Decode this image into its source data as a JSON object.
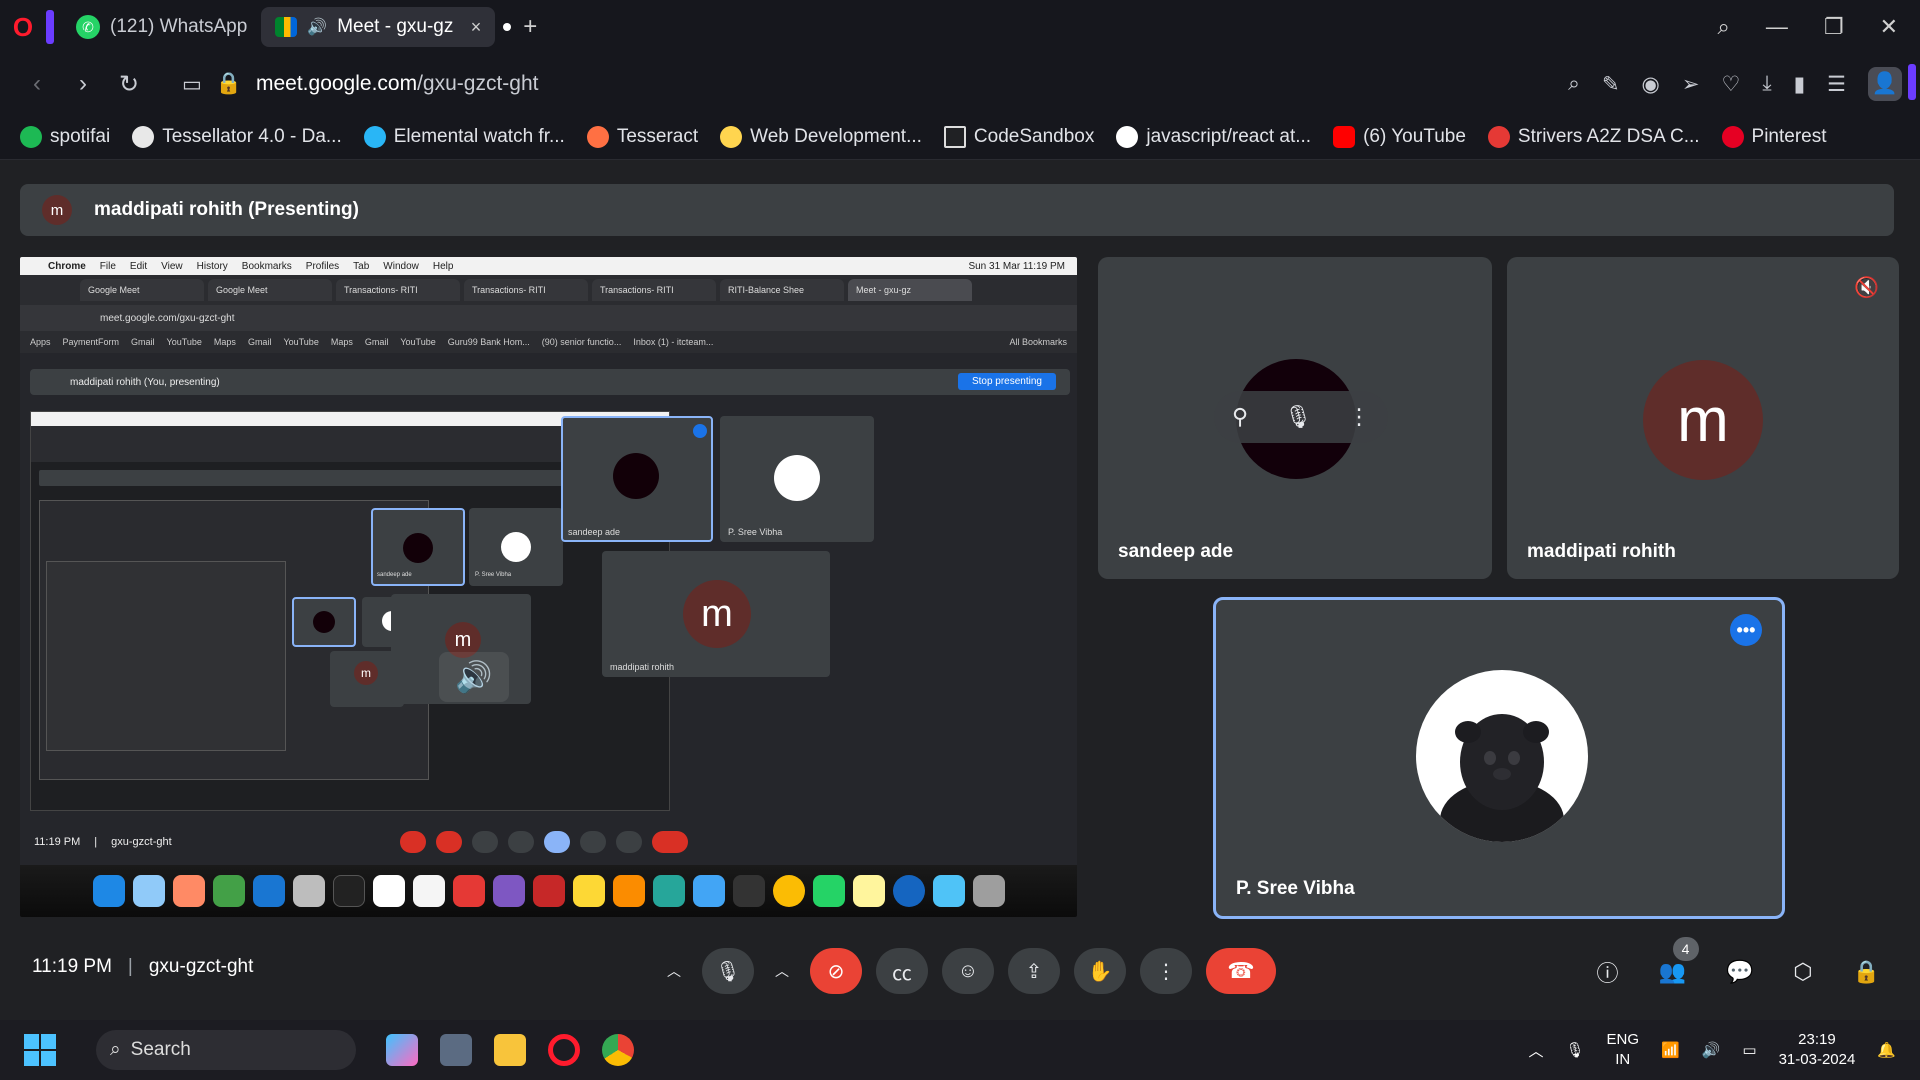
{
  "browser": {
    "tabs": [
      {
        "label": "(121) WhatsApp"
      },
      {
        "label": "Meet - gxu-gz",
        "close": "×"
      }
    ],
    "url_host": "meet.google.com",
    "url_path": "/gxu-gzct-ght",
    "bookmarks": [
      {
        "label": "spotifai",
        "color": "#1db954"
      },
      {
        "label": "Tessellator 4.0 - Da...",
        "color": "#e8e8e8"
      },
      {
        "label": "Elemental watch fr...",
        "color": "#29b6f6"
      },
      {
        "label": "Tesseract",
        "color": "#ff7043"
      },
      {
        "label": "Web Development...",
        "color": "#ffd54f"
      },
      {
        "label": "CodeSandbox",
        "color": "#202124"
      },
      {
        "label": "javascript/react at...",
        "color": "#ffffff"
      },
      {
        "label": "(6) YouTube",
        "color": "#ff0000"
      },
      {
        "label": "Strivers A2Z DSA C...",
        "color": "#e53935"
      },
      {
        "label": "Pinterest",
        "color": "#e60023"
      }
    ]
  },
  "meet": {
    "presenter_initial": "m",
    "presenter_label": "maddipati rohith (Presenting)",
    "shared_screen": {
      "menu": [
        "Chrome",
        "File",
        "Edit",
        "View",
        "History",
        "Bookmarks",
        "Profiles",
        "Tab",
        "Window",
        "Help"
      ],
      "clock": "Sun 31 Mar  11:19 PM",
      "tabs": [
        "Google Meet",
        "Google Meet",
        "Transactions- RITI",
        "Transactions- RITI",
        "Transactions- RITI",
        "RITI-Balance Shee",
        "Meet - gxu-gz"
      ],
      "url": "meet.google.com/gxu-gzct-ght",
      "bookmarks": [
        "Apps",
        "PaymentForm",
        "Gmail",
        "YouTube",
        "Maps",
        "Gmail",
        "YouTube",
        "Maps",
        "Gmail",
        "YouTube",
        "Guru99 Bank Hom...",
        "(90) senior functio...",
        "Inbox (1) - itcteam...",
        "All Bookmarks"
      ],
      "present_label": "maddipati rohith (You, presenting)",
      "stop_label": "Stop presenting",
      "tile_names": [
        "sandeep ade",
        "P. Sree Vibha",
        "maddipati rohith"
      ],
      "bottom_time": "11:19 PM",
      "bottom_code": "gxu-gzct-ght"
    },
    "participants": [
      {
        "name": "sandeep ade"
      },
      {
        "name": "maddipati rohith",
        "initial": "m"
      },
      {
        "name": "P. Sree Vibha"
      }
    ],
    "time": "11:19 PM",
    "separator": "|",
    "meeting_code": "gxu-gzct-ght",
    "participant_count": "4"
  },
  "taskbar": {
    "search_label": "Search",
    "lang_top": "ENG",
    "lang_bottom": "IN",
    "time": "23:19",
    "date": "31-03-2024"
  },
  "colors": {
    "accent_blue": "#8ab4f8",
    "meet_red": "#ea4335",
    "avatar_brown": "#5f2d2a"
  }
}
